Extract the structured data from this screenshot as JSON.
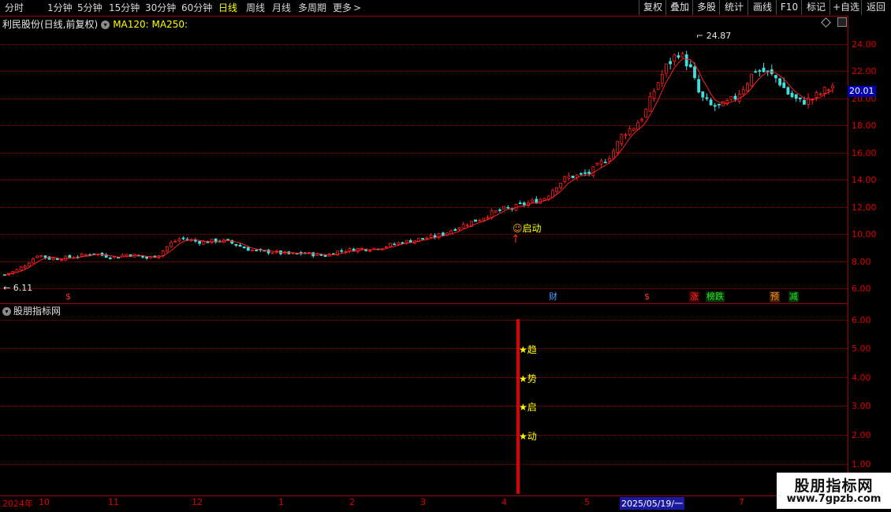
{
  "toolbar": {
    "periods": [
      "分时",
      "1分钟",
      "5分钟",
      "15分钟",
      "30分钟",
      "60分钟",
      "日线",
      "周线",
      "月线",
      "多周期"
    ],
    "active_period": "日线",
    "more": "更多",
    "more_icon": "chevron-right",
    "right_buttons": [
      "复权",
      "叠加",
      "多股",
      "统计",
      "画线",
      "F10",
      "标记",
      "+自选",
      "返回"
    ]
  },
  "header": {
    "stock_name": "利民股份(日线,前复权)",
    "ma_labels": "MA120: MA250:",
    "settings_icon": "circle-chevron-down"
  },
  "price_axis": {
    "labels": [
      "24.00",
      "22.00",
      "20.00",
      "18.00",
      "16.00",
      "14.00",
      "12.00",
      "10.00",
      "8.00",
      "6.00"
    ],
    "current_price": "20.01"
  },
  "annotations": {
    "high": "24.87",
    "low": "6.11",
    "signal_label": "启动"
  },
  "event_badges": [
    {
      "text": "$",
      "color": "#ff3030"
    },
    {
      "text": "财",
      "color": "#40a0ff"
    },
    {
      "text": "$",
      "color": "#ff3030"
    },
    {
      "text": "涨",
      "color": "#ff3030"
    },
    {
      "text": "榜跌",
      "color": "#30e030"
    },
    {
      "text": "预",
      "color": "#ff9020"
    },
    {
      "text": "减",
      "color": "#30e030"
    }
  ],
  "indicator": {
    "title": "股朋指标网",
    "axis_labels": [
      "6.00",
      "5.00",
      "4.00",
      "3.00",
      "2.00",
      "1.00"
    ],
    "signal_chars": [
      "★趋",
      "★势",
      "★启",
      "★动"
    ]
  },
  "date_axis": {
    "labels": [
      "2024年",
      "10",
      "11",
      "12",
      "1",
      "2",
      "3",
      "4",
      "5",
      "2025/05/19/一",
      "7"
    ]
  },
  "watermark": {
    "title": "股朋指标网",
    "url": "www.7gpzb.com"
  },
  "colors": {
    "up": "#ff2020",
    "down": "#40e0e0",
    "ma": "#ff2020",
    "grid": "#a00000",
    "signal": "#ffff00"
  },
  "chart_data": {
    "type": "candlestick",
    "title": "利民股份(日线,前复权)",
    "ylim": [
      5.5,
      25.5
    ],
    "close_path": [
      6.1,
      6.4,
      6.9,
      7.6,
      7.3,
      7.3,
      7.4,
      7.5,
      7.7,
      7.5,
      7.4,
      7.6,
      7.5,
      7.3,
      7.6,
      8.4,
      8.8,
      8.6,
      8.5,
      8.6,
      8.6,
      8.3,
      8.0,
      7.8,
      7.8,
      7.7,
      7.6,
      7.7,
      7.6,
      7.5,
      7.8,
      7.9,
      8.0,
      8.0,
      8.1,
      8.3,
      8.5,
      8.6,
      8.8,
      8.9,
      9.2,
      9.6,
      9.9,
      10.2,
      10.6,
      10.9,
      11.0,
      11.3,
      11.5,
      11.8,
      12.7,
      13.3,
      13.4,
      13.6,
      14.3,
      15.0,
      16.5,
      17.0,
      18.0,
      20.0,
      21.5,
      22.5,
      21.5,
      19.2,
      18.5,
      18.5,
      19.0,
      20.0,
      21.2,
      21.0,
      20.5,
      19.4,
      18.8,
      19.0,
      19.5,
      20.01
    ]
  }
}
